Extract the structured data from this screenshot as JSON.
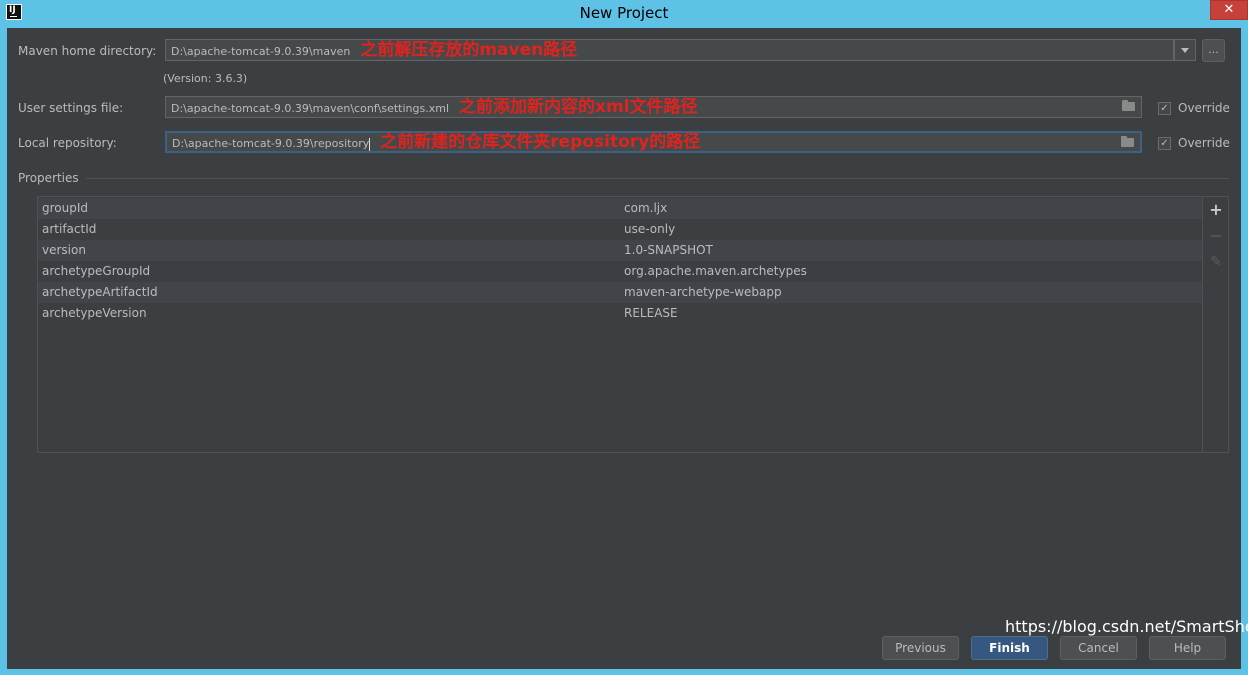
{
  "window": {
    "title": "New Project",
    "close_glyph": "✕",
    "app_icon_text": "IJ"
  },
  "maven_home": {
    "label": "Maven home directory:",
    "value": "D:\\apache-tomcat-9.0.39\\maven",
    "annotation": "之前解压存放的maven路径",
    "version": "(Version: 3.6.3)",
    "ellipsis": "..."
  },
  "user_settings": {
    "label": "User settings file:",
    "value": "D:\\apache-tomcat-9.0.39\\maven\\conf\\settings.xml",
    "annotation": "之前添加新内容的xml文件路径",
    "override_label": "Override",
    "override_checked": true
  },
  "local_repo": {
    "label": "Local repository:",
    "value": "D:\\apache-tomcat-9.0.39\\repository",
    "annotation": "之前新建的仓库文件夹repository的路径",
    "override_label": "Override",
    "override_checked": true
  },
  "properties": {
    "label": "Properties",
    "rows": [
      {
        "key": "groupId",
        "value": "com.ljx"
      },
      {
        "key": "artifactId",
        "value": "use-only"
      },
      {
        "key": "version",
        "value": "1.0-SNAPSHOT"
      },
      {
        "key": "archetypeGroupId",
        "value": "org.apache.maven.archetypes"
      },
      {
        "key": "archetypeArtifactId",
        "value": "maven-archetype-webapp"
      },
      {
        "key": "archetypeVersion",
        "value": "RELEASE"
      }
    ],
    "tools": {
      "add": "+",
      "remove": "−",
      "edit": "✎"
    }
  },
  "buttons": {
    "previous": "Previous",
    "finish": "Finish",
    "cancel": "Cancel",
    "help": "Help"
  },
  "watermark": "https://blog.csdn.net/SmartShepi",
  "colors": {
    "accent": "#365880",
    "annotation": "#e0231e",
    "background": "#3c3f41"
  }
}
